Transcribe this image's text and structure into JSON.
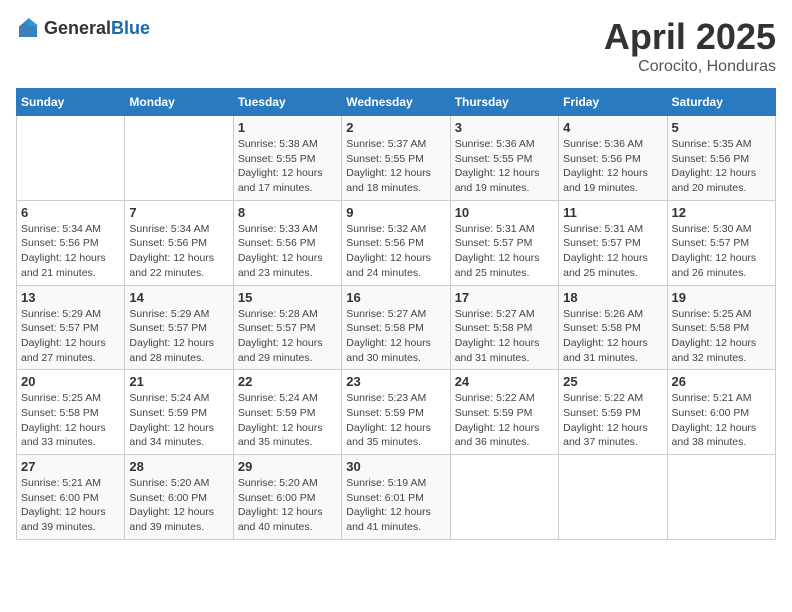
{
  "logo": {
    "text_general": "General",
    "text_blue": "Blue"
  },
  "title": "April 2025",
  "location": "Corocito, Honduras",
  "days_of_week": [
    "Sunday",
    "Monday",
    "Tuesday",
    "Wednesday",
    "Thursday",
    "Friday",
    "Saturday"
  ],
  "weeks": [
    [
      {
        "day": "",
        "info": ""
      },
      {
        "day": "",
        "info": ""
      },
      {
        "day": "1",
        "info": "Sunrise: 5:38 AM\nSunset: 5:55 PM\nDaylight: 12 hours and 17 minutes."
      },
      {
        "day": "2",
        "info": "Sunrise: 5:37 AM\nSunset: 5:55 PM\nDaylight: 12 hours and 18 minutes."
      },
      {
        "day": "3",
        "info": "Sunrise: 5:36 AM\nSunset: 5:55 PM\nDaylight: 12 hours and 19 minutes."
      },
      {
        "day": "4",
        "info": "Sunrise: 5:36 AM\nSunset: 5:56 PM\nDaylight: 12 hours and 19 minutes."
      },
      {
        "day": "5",
        "info": "Sunrise: 5:35 AM\nSunset: 5:56 PM\nDaylight: 12 hours and 20 minutes."
      }
    ],
    [
      {
        "day": "6",
        "info": "Sunrise: 5:34 AM\nSunset: 5:56 PM\nDaylight: 12 hours and 21 minutes."
      },
      {
        "day": "7",
        "info": "Sunrise: 5:34 AM\nSunset: 5:56 PM\nDaylight: 12 hours and 22 minutes."
      },
      {
        "day": "8",
        "info": "Sunrise: 5:33 AM\nSunset: 5:56 PM\nDaylight: 12 hours and 23 minutes."
      },
      {
        "day": "9",
        "info": "Sunrise: 5:32 AM\nSunset: 5:56 PM\nDaylight: 12 hours and 24 minutes."
      },
      {
        "day": "10",
        "info": "Sunrise: 5:31 AM\nSunset: 5:57 PM\nDaylight: 12 hours and 25 minutes."
      },
      {
        "day": "11",
        "info": "Sunrise: 5:31 AM\nSunset: 5:57 PM\nDaylight: 12 hours and 25 minutes."
      },
      {
        "day": "12",
        "info": "Sunrise: 5:30 AM\nSunset: 5:57 PM\nDaylight: 12 hours and 26 minutes."
      }
    ],
    [
      {
        "day": "13",
        "info": "Sunrise: 5:29 AM\nSunset: 5:57 PM\nDaylight: 12 hours and 27 minutes."
      },
      {
        "day": "14",
        "info": "Sunrise: 5:29 AM\nSunset: 5:57 PM\nDaylight: 12 hours and 28 minutes."
      },
      {
        "day": "15",
        "info": "Sunrise: 5:28 AM\nSunset: 5:57 PM\nDaylight: 12 hours and 29 minutes."
      },
      {
        "day": "16",
        "info": "Sunrise: 5:27 AM\nSunset: 5:58 PM\nDaylight: 12 hours and 30 minutes."
      },
      {
        "day": "17",
        "info": "Sunrise: 5:27 AM\nSunset: 5:58 PM\nDaylight: 12 hours and 31 minutes."
      },
      {
        "day": "18",
        "info": "Sunrise: 5:26 AM\nSunset: 5:58 PM\nDaylight: 12 hours and 31 minutes."
      },
      {
        "day": "19",
        "info": "Sunrise: 5:25 AM\nSunset: 5:58 PM\nDaylight: 12 hours and 32 minutes."
      }
    ],
    [
      {
        "day": "20",
        "info": "Sunrise: 5:25 AM\nSunset: 5:58 PM\nDaylight: 12 hours and 33 minutes."
      },
      {
        "day": "21",
        "info": "Sunrise: 5:24 AM\nSunset: 5:59 PM\nDaylight: 12 hours and 34 minutes."
      },
      {
        "day": "22",
        "info": "Sunrise: 5:24 AM\nSunset: 5:59 PM\nDaylight: 12 hours and 35 minutes."
      },
      {
        "day": "23",
        "info": "Sunrise: 5:23 AM\nSunset: 5:59 PM\nDaylight: 12 hours and 35 minutes."
      },
      {
        "day": "24",
        "info": "Sunrise: 5:22 AM\nSunset: 5:59 PM\nDaylight: 12 hours and 36 minutes."
      },
      {
        "day": "25",
        "info": "Sunrise: 5:22 AM\nSunset: 5:59 PM\nDaylight: 12 hours and 37 minutes."
      },
      {
        "day": "26",
        "info": "Sunrise: 5:21 AM\nSunset: 6:00 PM\nDaylight: 12 hours and 38 minutes."
      }
    ],
    [
      {
        "day": "27",
        "info": "Sunrise: 5:21 AM\nSunset: 6:00 PM\nDaylight: 12 hours and 39 minutes."
      },
      {
        "day": "28",
        "info": "Sunrise: 5:20 AM\nSunset: 6:00 PM\nDaylight: 12 hours and 39 minutes."
      },
      {
        "day": "29",
        "info": "Sunrise: 5:20 AM\nSunset: 6:00 PM\nDaylight: 12 hours and 40 minutes."
      },
      {
        "day": "30",
        "info": "Sunrise: 5:19 AM\nSunset: 6:01 PM\nDaylight: 12 hours and 41 minutes."
      },
      {
        "day": "",
        "info": ""
      },
      {
        "day": "",
        "info": ""
      },
      {
        "day": "",
        "info": ""
      }
    ]
  ]
}
